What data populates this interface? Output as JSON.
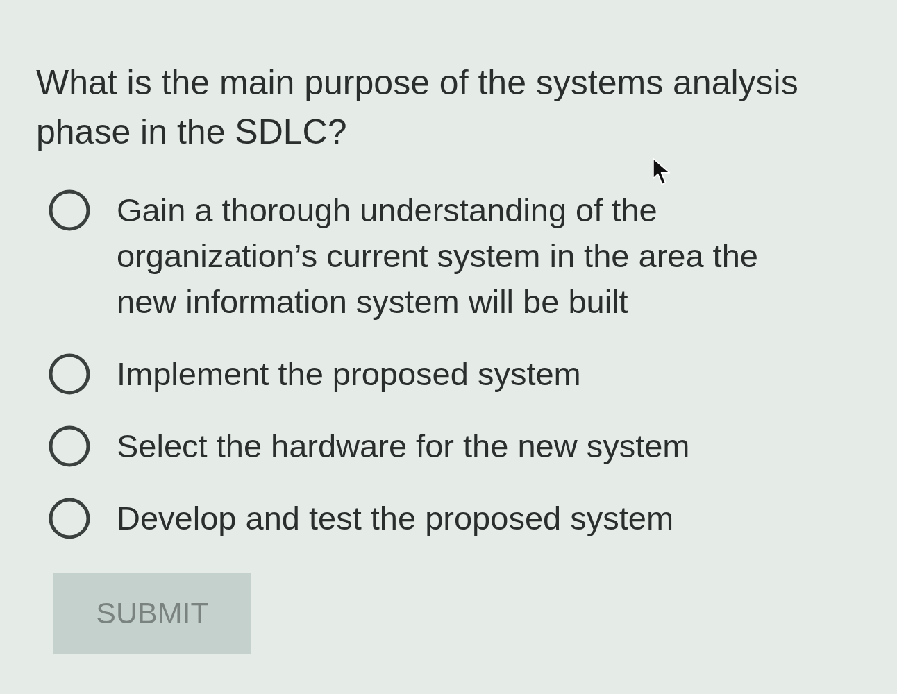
{
  "question": {
    "text": "What is the main purpose of the systems analysis phase in the SDLC?"
  },
  "options": [
    {
      "label": "Gain a thorough understanding of the organization’s current system in the area the new information system will be built",
      "selected": false
    },
    {
      "label": "Implement the proposed system",
      "selected": false
    },
    {
      "label": "Select the hardware for the new system",
      "selected": false
    },
    {
      "label": "Develop and test the proposed system",
      "selected": false
    }
  ],
  "submit_button": {
    "label": "SUBMIT",
    "disabled": true
  }
}
